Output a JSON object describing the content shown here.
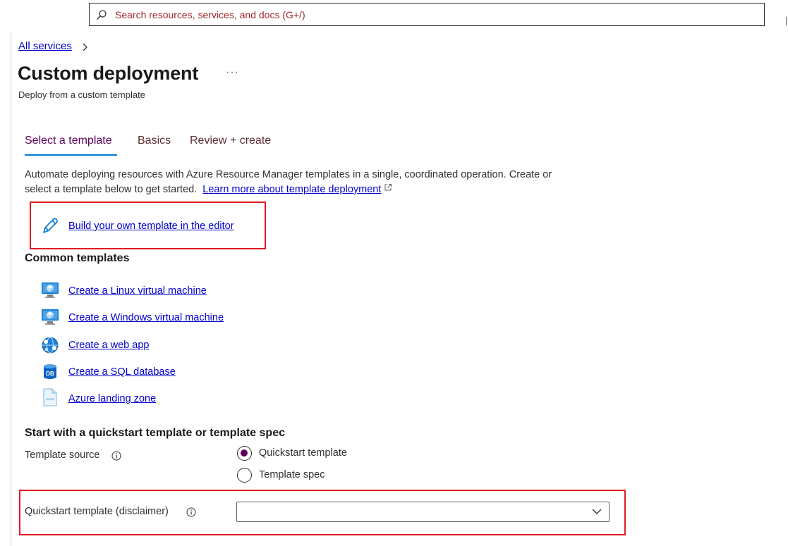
{
  "search": {
    "placeholder": "Search resources, services, and docs (G+/)"
  },
  "breadcrumb": {
    "items": [
      {
        "label": "All services"
      }
    ]
  },
  "page": {
    "title": "Custom deployment",
    "more_label": "···",
    "subtitle": "Deploy from a custom template"
  },
  "tabs": [
    {
      "label": "Select a template",
      "active": true
    },
    {
      "label": "Basics",
      "active": false
    },
    {
      "label": "Review + create",
      "active": false
    }
  ],
  "description": {
    "line1": "Automate deploying resources with Azure Resource Manager templates in a single, coordinated operation. Create or",
    "line2": "select a template below to get started.",
    "link": "Learn more about template deployment"
  },
  "editor_link": {
    "label": "Build your own template in the editor",
    "icon": "pencil-icon"
  },
  "common_templates": {
    "heading": "Common templates",
    "items": [
      {
        "label": "Create a Linux virtual machine",
        "icon": "virtual-machine-icon"
      },
      {
        "label": "Create a Windows virtual machine",
        "icon": "virtual-machine-icon"
      },
      {
        "label": "Create a web app",
        "icon": "web-app-icon"
      },
      {
        "label": "Create a SQL database",
        "icon": "sql-database-icon"
      },
      {
        "label": "Azure landing zone",
        "icon": "json-file-icon"
      }
    ]
  },
  "quickstart": {
    "heading": "Start with a quickstart template or template spec",
    "source_label": "Template source",
    "options": [
      {
        "label": "Quickstart template",
        "selected": true
      },
      {
        "label": "Template spec",
        "selected": false
      }
    ],
    "template_label": "Quickstart template (disclaimer)",
    "template_value": ""
  },
  "colors": {
    "link": "#0000cc",
    "accent_tab": "#0078d4",
    "active_tab_text": "#5c005c",
    "highlight_box": "#e01b22",
    "radio_selected": "#5c005c"
  }
}
